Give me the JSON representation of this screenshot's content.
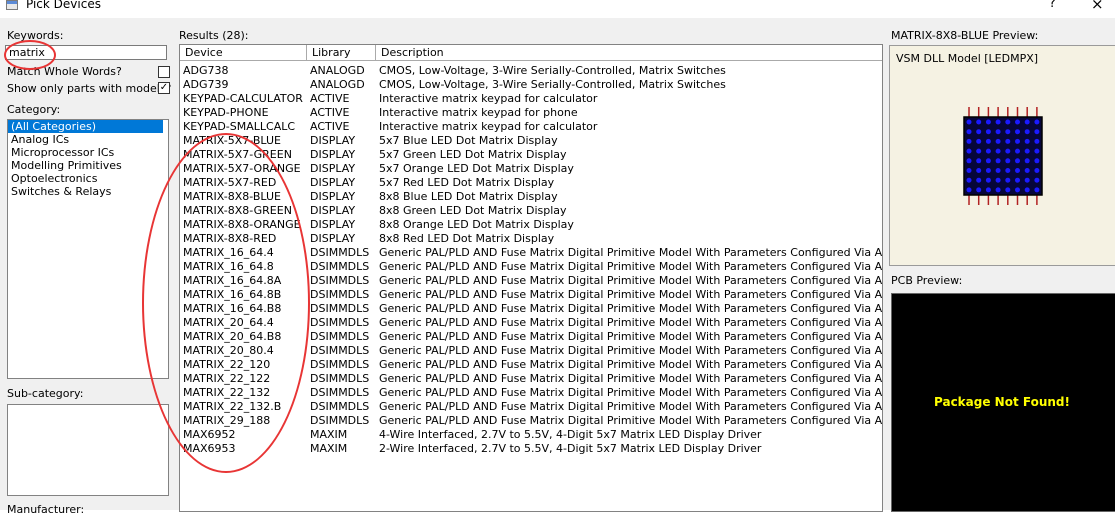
{
  "window": {
    "title": "Pick Devices",
    "help": "?",
    "close": "×"
  },
  "left": {
    "keywords_label": "Keywords:",
    "keywords_value": "matrix",
    "match_whole_label": "Match Whole Words?",
    "match_whole_checked": false,
    "show_models_label": "Show only parts with models?",
    "show_models_checked": true,
    "check_mark": "✓",
    "category_label": "Category:",
    "categories": [
      "(All Categories)",
      "Analog ICs",
      "Microprocessor ICs",
      "Modelling Primitives",
      "Optoelectronics",
      "Switches & Relays"
    ],
    "subcategory_label": "Sub-category:",
    "manufacturer_label": "Manufacturer:"
  },
  "results": {
    "label": "Results (28):",
    "columns": [
      "Device",
      "Library",
      "Description"
    ],
    "rows": [
      [
        "ADG738",
        "ANALOGD",
        "CMOS, Low-Voltage, 3-Wire Serially-Controlled, Matrix Switches"
      ],
      [
        "ADG739",
        "ANALOGD",
        "CMOS, Low-Voltage, 3-Wire Serially-Controlled, Matrix Switches"
      ],
      [
        "KEYPAD-CALCULATOR",
        "ACTIVE",
        "Interactive matrix keypad for calculator"
      ],
      [
        "KEYPAD-PHONE",
        "ACTIVE",
        "Interactive matrix keypad for phone"
      ],
      [
        "KEYPAD-SMALLCALC",
        "ACTIVE",
        "Interactive matrix keypad for calculator"
      ],
      [
        "MATRIX-5X7-BLUE",
        "DISPLAY",
        "5x7 Blue LED Dot Matrix Display"
      ],
      [
        "MATRIX-5X7-GREEN",
        "DISPLAY",
        "5x7 Green LED Dot Matrix Display"
      ],
      [
        "MATRIX-5X7-ORANGE",
        "DISPLAY",
        "5x7 Orange LED Dot Matrix Display"
      ],
      [
        "MATRIX-5X7-RED",
        "DISPLAY",
        "5x7 Red LED Dot Matrix Display"
      ],
      [
        "MATRIX-8X8-BLUE",
        "DISPLAY",
        "8x8 Blue LED Dot Matrix Display"
      ],
      [
        "MATRIX-8X8-GREEN",
        "DISPLAY",
        "8x8 Green LED Dot Matrix Display"
      ],
      [
        "MATRIX-8X8-ORANGE",
        "DISPLAY",
        "8x8 Orange LED Dot Matrix Display"
      ],
      [
        "MATRIX-8X8-RED",
        "DISPLAY",
        "8x8 Red LED Dot Matrix Display"
      ],
      [
        "MATRIX_16_64.4",
        "DSIMMDLS",
        "Generic PAL/PLD AND Fuse Matrix Digital Primitive Model With Parameters Configured Via A JEDEC Fuse"
      ],
      [
        "MATRIX_16_64.8",
        "DSIMMDLS",
        "Generic PAL/PLD AND Fuse Matrix Digital Primitive Model With Parameters Configured Via A JEDEC Fuse"
      ],
      [
        "MATRIX_16_64.8A",
        "DSIMMDLS",
        "Generic PAL/PLD AND Fuse Matrix Digital Primitive Model With Parameters Configured Via A JEDEC Fuse"
      ],
      [
        "MATRIX_16_64.8B",
        "DSIMMDLS",
        "Generic PAL/PLD AND Fuse Matrix Digital Primitive Model With Parameters Configured Via A JEDEC Fuse"
      ],
      [
        "MATRIX_16_64.B8",
        "DSIMMDLS",
        "Generic PAL/PLD AND Fuse Matrix Digital Primitive Model With Parameters Configured Via A JEDEC Fuse"
      ],
      [
        "MATRIX_20_64.4",
        "DSIMMDLS",
        "Generic PAL/PLD AND Fuse Matrix Digital Primitive Model With Parameters Configured Via A JEDEC Fuse"
      ],
      [
        "MATRIX_20_64.B8",
        "DSIMMDLS",
        "Generic PAL/PLD AND Fuse Matrix Digital Primitive Model With Parameters Configured Via A JEDEC Fuse"
      ],
      [
        "MATRIX_20_80.4",
        "DSIMMDLS",
        "Generic PAL/PLD AND Fuse Matrix Digital Primitive Model With Parameters Configured Via A JEDEC Fuse"
      ],
      [
        "MATRIX_22_120",
        "DSIMMDLS",
        "Generic PAL/PLD AND Fuse Matrix Digital Primitive Model With Parameters Configured Via A JEDEC Fuse"
      ],
      [
        "MATRIX_22_122",
        "DSIMMDLS",
        "Generic PAL/PLD AND Fuse Matrix Digital Primitive Model With Parameters Configured Via A JEDEC Fuse"
      ],
      [
        "MATRIX_22_132",
        "DSIMMDLS",
        "Generic PAL/PLD AND Fuse Matrix Digital Primitive Model With Parameters Configured Via A JEDEC Fuse"
      ],
      [
        "MATRIX_22_132.B",
        "DSIMMDLS",
        "Generic PAL/PLD AND Fuse Matrix Digital Primitive Model With Parameters Configured Via A JEDEC Fuse"
      ],
      [
        "MATRIX_29_188",
        "DSIMMDLS",
        "Generic PAL/PLD AND Fuse Matrix Digital Primitive Model With Parameters Configured Via A JEDEC Fuse"
      ],
      [
        "MAX6952",
        "MAXIM",
        "4-Wire Interfaced, 2.7V to 5.5V, 4-Digit 5x7 Matrix LED Display Driver"
      ],
      [
        "MAX6953",
        "MAXIM",
        "2-Wire Interfaced, 2.7V to 5.5V, 4-Digit 5x7 Matrix LED Display Driver"
      ]
    ]
  },
  "preview": {
    "title": "MATRIX-8X8-BLUE Preview:",
    "model_label": "VSM DLL Model [LEDMPX]",
    "pcb_title": "PCB Preview:",
    "pcb_message": "Package Not Found!",
    "led_color": "#1a1aff",
    "pin_color": "#b22222"
  },
  "colors": {
    "selection": "#0078d7",
    "annotation": "#e83535",
    "pcb_text": "#ffff00"
  }
}
